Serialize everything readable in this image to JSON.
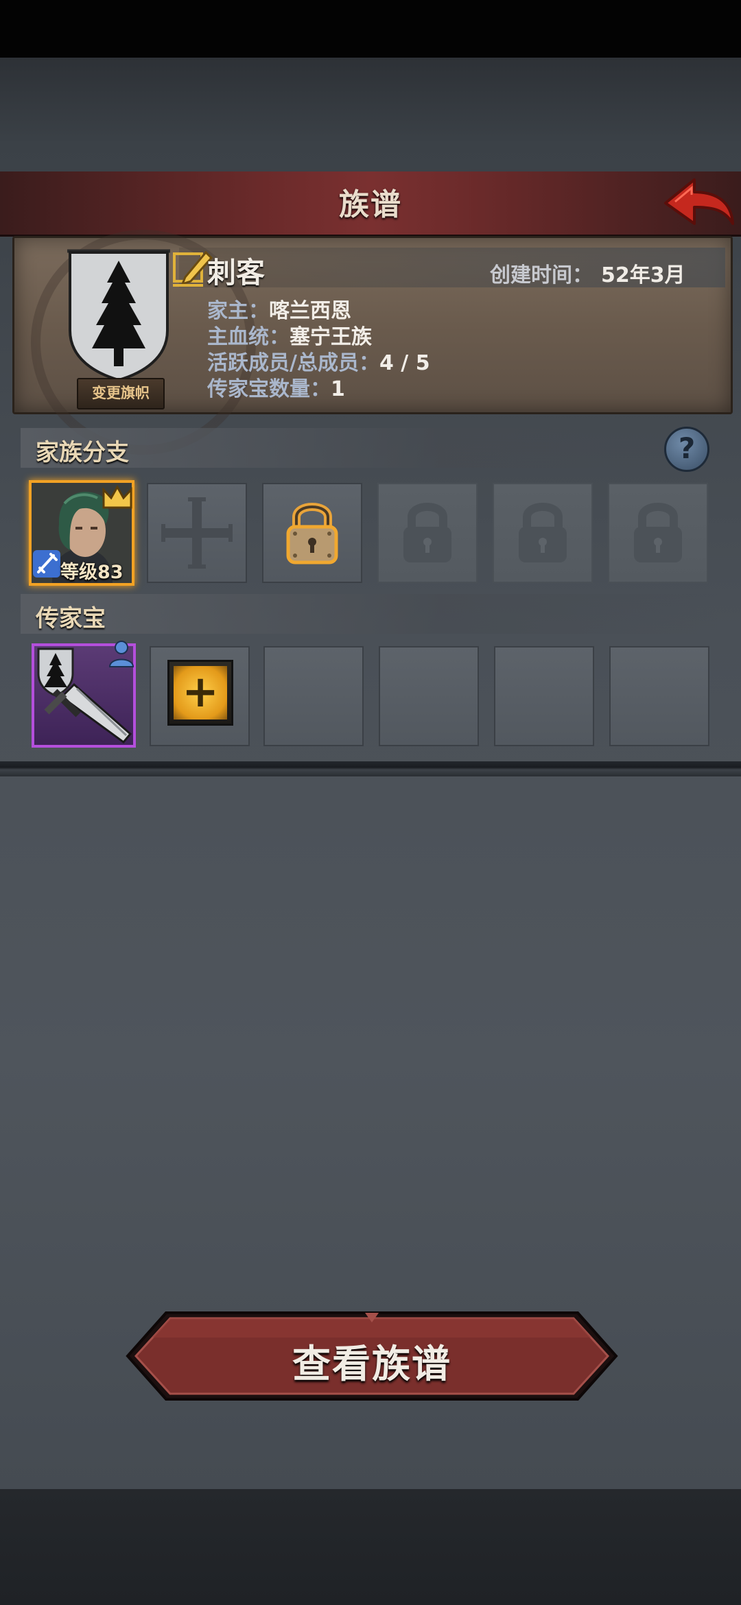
{
  "header": {
    "title": "族谱"
  },
  "clan": {
    "name": "刺客",
    "change_banner_label": "变更旗帜",
    "created_label": "创建时间：",
    "created_value": "52年3月",
    "rows": [
      {
        "label": "家主：",
        "value": "喀兰西恩"
      },
      {
        "label": "主血统：",
        "value": "塞宁王族"
      },
      {
        "label": "活跃成员/总成员：",
        "value": "4 / 5"
      },
      {
        "label": "传家宝数量：",
        "value": "1"
      }
    ]
  },
  "branches": {
    "title": "家族分支",
    "help_label": "?",
    "member_level": "等级83",
    "slots": [
      "member",
      "empty-cross",
      "lock-active",
      "lock",
      "lock",
      "lock"
    ]
  },
  "heirlooms": {
    "title": "传家宝",
    "add_label": "+",
    "slots": [
      "sword",
      "add",
      "empty",
      "empty",
      "empty",
      "empty"
    ]
  },
  "actions": {
    "view_tree_label": "查看族谱"
  },
  "colors": {
    "header_red": "#7a3030",
    "member_border": "#f2a224",
    "heirloom_border": "#b44fdc",
    "card_bg": "#6a5b4d"
  },
  "icons": [
    "back-arrow-icon",
    "tree-banner-icon",
    "edit-pencil-icon",
    "help-icon",
    "crown-icon",
    "sword-class-icon",
    "cross-icon",
    "padlock-icon",
    "sword-icon",
    "add-icon",
    "person-icon"
  ]
}
